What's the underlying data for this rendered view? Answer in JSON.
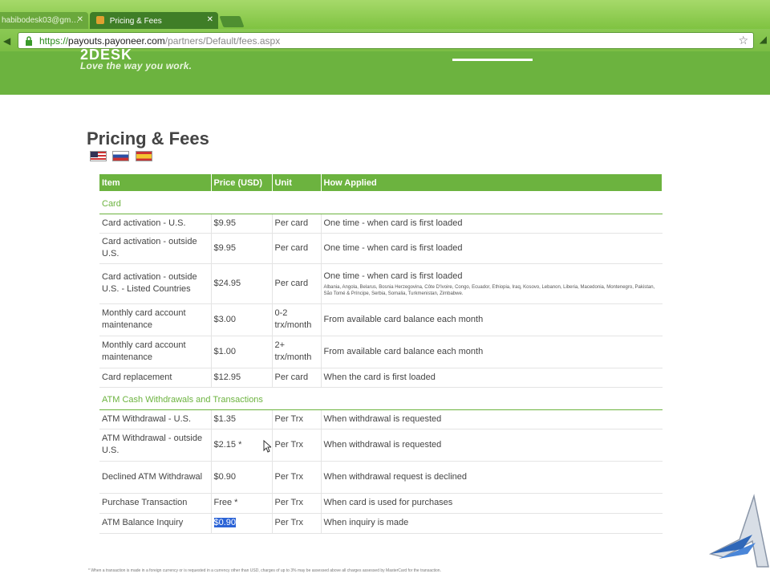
{
  "browser": {
    "tabs": [
      {
        "label": "habibodesk03@gm…",
        "active": false
      },
      {
        "label": "Pricing & Fees",
        "active": true
      }
    ],
    "url": {
      "scheme": "https://",
      "host": "payouts.payoneer.com",
      "path": "/partners/Default/fees.aspx"
    },
    "icons": [
      "lock-icon",
      "star-icon",
      "wrench-icon"
    ]
  },
  "header": {
    "logo_fragment": "2DESK",
    "tagline": "Love the way you work."
  },
  "page": {
    "title": "Pricing & Fees",
    "flags": [
      "us-flag",
      "ru-flag",
      "es-flag"
    ]
  },
  "table": {
    "columns": [
      "Item",
      "Price (USD)",
      "Unit",
      "How Applied"
    ],
    "sections": [
      {
        "name": "Card",
        "rows": [
          {
            "item": "Card activation - U.S.",
            "price": "$9.95",
            "unit": "Per card",
            "how": "One time - when card is first loaded"
          },
          {
            "item": "Card activation - outside U.S.",
            "price": "$9.95",
            "unit": "Per card",
            "how": "One time - when card is first loaded"
          },
          {
            "item": "Card activation - outside U.S. - Listed Countries",
            "price": "$24.95",
            "unit": "Per card",
            "how": "One time - when card is first loaded",
            "countries": "Albania, Angola, Belarus, Bosnia Herzegovina, Côte D'Ivoire, Congo, Ecuador, Ethiopia, Iraq, Kosovo, Lebanon, Liberia, Macedonia, Montenegro, Pakistan, São Tomé & Príncipe, Serbia, Somalia, Turkmenistan, Zimbabwe."
          },
          {
            "item": "Monthly card account maintenance",
            "price": "$3.00",
            "unit": "0-2 trx/month",
            "how": "From available card balance each month"
          },
          {
            "item": "Monthly card account maintenance",
            "price": "$1.00",
            "unit": "2+ trx/month",
            "how": "From available card balance each month"
          },
          {
            "item": "Card replacement",
            "price": "$12.95",
            "unit": "Per card",
            "how": "When the card is first loaded"
          }
        ]
      },
      {
        "name": "ATM Cash Withdrawals and Transactions",
        "rows": [
          {
            "item": "ATM Withdrawal - U.S.",
            "price": "$1.35",
            "unit": "Per Trx",
            "how": "When withdrawal is requested"
          },
          {
            "item": "ATM Withdrawal - outside U.S.",
            "price": "$2.15 *",
            "unit": "Per Trx",
            "how": "When withdrawal is requested"
          },
          {
            "item": "Declined ATM Withdrawal",
            "price": "$0.90",
            "unit": "Per Trx",
            "how": "When withdrawal request is declined"
          },
          {
            "item": "Purchase Transaction",
            "price": "Free *",
            "unit": "Per Trx",
            "how": "When card is used for purchases"
          },
          {
            "item": "ATM Balance Inquiry",
            "price": "$0.90",
            "unit": "Per Trx",
            "how": "When inquiry is made",
            "highlighted": true
          }
        ]
      }
    ]
  },
  "footnote": "* When a transaction is made in a foreign currency or is requested in a currency other than USD, charges of up to 3% may be assessed above all charges assessed by MasterCard for the transaction."
}
